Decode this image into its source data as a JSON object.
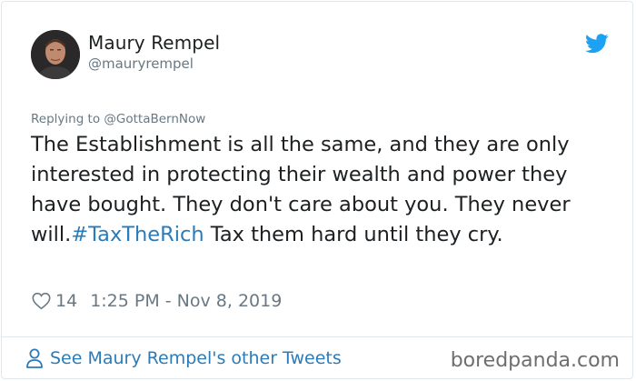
{
  "user": {
    "display_name": "Maury Rempel",
    "handle": "@mauryrempel"
  },
  "tweet": {
    "replying_to": "Replying to @GottaBernNow",
    "text_before": "The Establishment is all the same, and they are only interested in protecting their wealth and power they have bought.  They don't care about you. They never will.",
    "hashtag": "#TaxTheRich",
    "text_after": "  Tax them hard until they cry.",
    "likes": "14",
    "timestamp": "1:25 PM - Nov 8, 2019"
  },
  "footer": {
    "see_more": "See Maury Rempel's other Tweets",
    "watermark": "boredpanda.com"
  },
  "colors": {
    "link": "#2b7bb9",
    "muted": "#697882",
    "twitter_blue": "#1da1f2"
  },
  "icons": {
    "bird": "twitter-bird-icon",
    "heart": "heart-outline-icon",
    "person": "person-outline-icon"
  }
}
